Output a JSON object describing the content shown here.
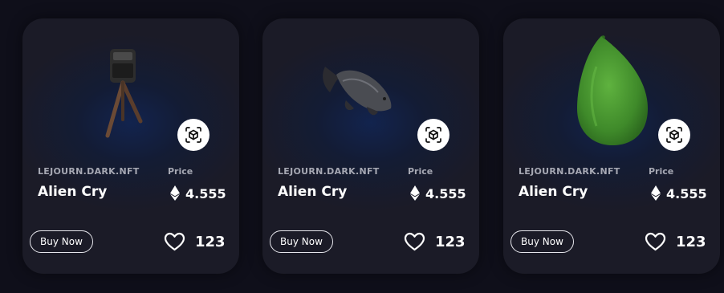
{
  "cards": [
    {
      "collection": "LEJOURN.DARK.NFT",
      "name": "Alien Cry",
      "price_label": "Price",
      "price": "4.555",
      "buy_label": "Buy Now",
      "likes": "123",
      "art": "tripod-robot",
      "ar_icon": "ar-cube-icon",
      "currency_icon": "ethereum-icon",
      "like_icon": "heart-icon"
    },
    {
      "collection": "LEJOURN.DARK.NFT",
      "name": "Alien Cry",
      "price_label": "Price",
      "price": "4.555",
      "buy_label": "Buy Now",
      "likes": "123",
      "art": "dark-fish",
      "ar_icon": "ar-cube-icon",
      "currency_icon": "ethereum-icon",
      "like_icon": "heart-icon"
    },
    {
      "collection": "LEJOURN.DARK.NFT",
      "name": "Alien Cry",
      "price_label": "Price",
      "price": "4.555",
      "buy_label": "Buy Now",
      "likes": "123",
      "art": "green-papaya",
      "ar_icon": "ar-cube-icon",
      "currency_icon": "ethereum-icon",
      "like_icon": "heart-icon"
    }
  ],
  "colors": {
    "page_bg": "#0f0f1a",
    "card_bg": "#1b1b27",
    "card_glow": "#122450",
    "muted_text": "#a6a8b3",
    "text": "#ffffff",
    "fruit_green": "#4e9a33"
  }
}
